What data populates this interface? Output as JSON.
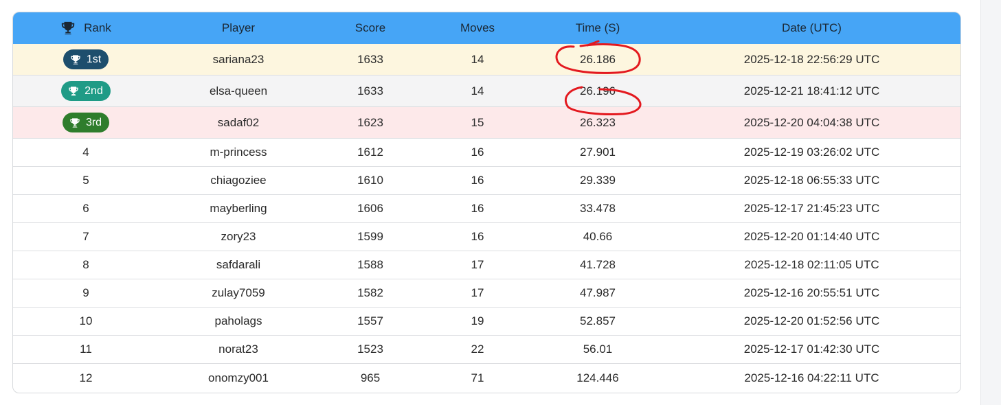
{
  "header": {
    "rank": "Rank",
    "player": "Player",
    "score": "Score",
    "moves": "Moves",
    "time": "Time (S)",
    "date": "Date (UTC)"
  },
  "podium": [
    {
      "badge": "1st",
      "player": "sariana23",
      "score": "1633",
      "moves": "14",
      "time": "26.186",
      "date": "2025-12-18 22:56:29 UTC",
      "badge_color": "#1d4e6d",
      "row_color": "#fdf6df"
    },
    {
      "badge": "2nd",
      "player": "elsa-queen",
      "score": "1633",
      "moves": "14",
      "time": "26.196",
      "date": "2025-12-21 18:41:12 UTC",
      "badge_color": "#1f9b86",
      "row_color": "#f4f4f5"
    },
    {
      "badge": "3rd",
      "player": "sadaf02",
      "score": "1623",
      "moves": "15",
      "time": "26.323",
      "date": "2025-12-20 04:04:38 UTC",
      "badge_color": "#2f7d2c",
      "row_color": "#fde9ea"
    }
  ],
  "rows": [
    {
      "rank": "4",
      "player": "m-princess",
      "score": "1612",
      "moves": "16",
      "time": "27.901",
      "date": "2025-12-19 03:26:02 UTC"
    },
    {
      "rank": "5",
      "player": "chiagoziee",
      "score": "1610",
      "moves": "16",
      "time": "29.339",
      "date": "2025-12-18 06:55:33 UTC"
    },
    {
      "rank": "6",
      "player": "mayberling",
      "score": "1606",
      "moves": "16",
      "time": "33.478",
      "date": "2025-12-17 21:45:23 UTC"
    },
    {
      "rank": "7",
      "player": "zory23",
      "score": "1599",
      "moves": "16",
      "time": "40.66",
      "date": "2025-12-20 01:14:40 UTC"
    },
    {
      "rank": "8",
      "player": "safdarali",
      "score": "1588",
      "moves": "17",
      "time": "41.728",
      "date": "2025-12-18 02:11:05 UTC"
    },
    {
      "rank": "9",
      "player": "zulay7059",
      "score": "1582",
      "moves": "17",
      "time": "47.987",
      "date": "2025-12-16 20:55:51 UTC"
    },
    {
      "rank": "10",
      "player": "paholags",
      "score": "1557",
      "moves": "19",
      "time": "52.857",
      "date": "2025-12-20 01:52:56 UTC"
    },
    {
      "rank": "11",
      "player": "norat23",
      "score": "1523",
      "moves": "22",
      "time": "56.01",
      "date": "2025-12-17 01:42:30 UTC"
    },
    {
      "rank": "12",
      "player": "onomzy001",
      "score": "965",
      "moves": "71",
      "time": "124.446",
      "date": "2025-12-16 04:22:11 UTC"
    }
  ],
  "colors": {
    "header_bg": "#46a5f6",
    "annotation": "#e3191f"
  },
  "icons": {
    "rank_header": "trophy-icon",
    "badge": "trophy-icon"
  }
}
